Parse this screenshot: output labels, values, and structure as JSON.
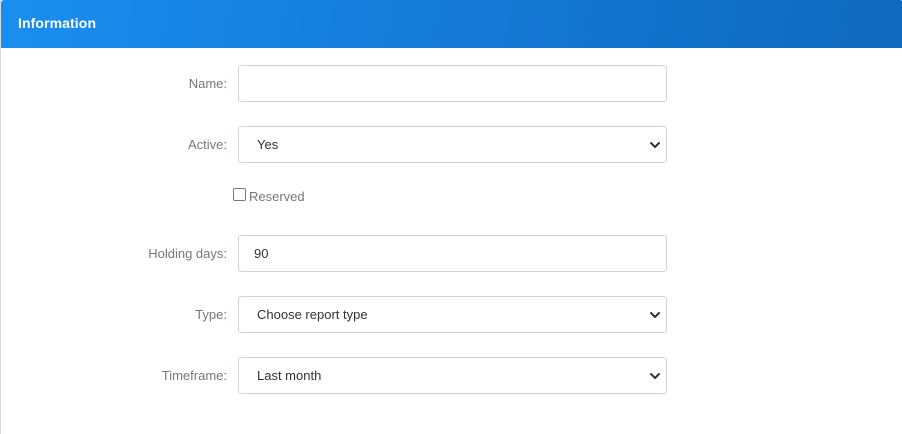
{
  "header": {
    "title": "Information"
  },
  "form": {
    "name": {
      "label": "Name:",
      "value": ""
    },
    "active": {
      "label": "Active:",
      "value": "Yes"
    },
    "reserved": {
      "label": "Reserved",
      "checked": false
    },
    "holding_days": {
      "label": "Holding days:",
      "value": "90"
    },
    "type": {
      "label": "Type:",
      "value": "Choose report type"
    },
    "timeframe": {
      "label": "Timeframe:",
      "value": "Last month"
    }
  },
  "icons": {
    "select_arrow": "chevron-down-icon"
  },
  "colors": {
    "header_start": "#1a8ef0",
    "header_end": "#0f69bd"
  }
}
